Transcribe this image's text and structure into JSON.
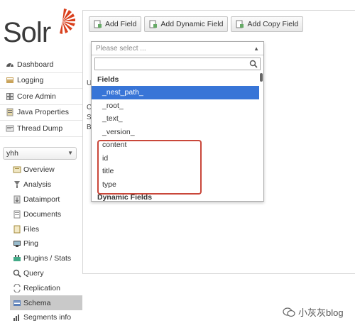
{
  "logo": {
    "text": "Solr"
  },
  "nav": {
    "items": [
      {
        "label": "Dashboard",
        "icon": "dashboard-icon"
      },
      {
        "label": "Logging",
        "icon": "logging-icon"
      },
      {
        "label": "Core Admin",
        "icon": "core-admin-icon"
      },
      {
        "label": "Java Properties",
        "icon": "java-properties-icon"
      },
      {
        "label": "Thread Dump",
        "icon": "thread-dump-icon"
      }
    ]
  },
  "core_selector": {
    "value": "yhh"
  },
  "core_nav": {
    "items": [
      {
        "label": "Overview"
      },
      {
        "label": "Analysis"
      },
      {
        "label": "Dataimport"
      },
      {
        "label": "Documents"
      },
      {
        "label": "Files"
      },
      {
        "label": "Ping"
      },
      {
        "label": "Plugins / Stats"
      },
      {
        "label": "Query"
      },
      {
        "label": "Replication"
      },
      {
        "label": "Schema"
      },
      {
        "label": "Segments info"
      }
    ]
  },
  "toolbar": {
    "add_field": "Add Field",
    "add_dynamic_field": "Add Dynamic Field",
    "add_copy_field": "Add Copy Field"
  },
  "background_letters": {
    "u": "U",
    "c": "C",
    "s": "S",
    "b": "B"
  },
  "dropdown": {
    "placeholder": "Please select ...",
    "group_fields": "Fields",
    "options": [
      "_nest_path_",
      "_root_",
      "_text_",
      "_version_",
      "content",
      "id",
      "title",
      "type"
    ],
    "group_dynamic": "Dynamic Fields"
  },
  "watermark": {
    "text": "小灰灰blog"
  }
}
